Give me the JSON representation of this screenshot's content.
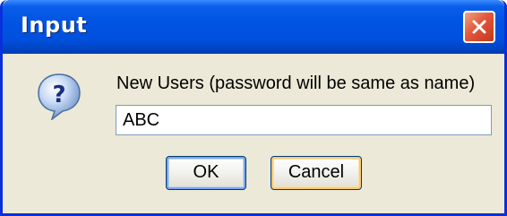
{
  "dialog": {
    "title": "Input",
    "prompt": "New Users (password will be same as name)",
    "input_value": "ABC",
    "ok_label": "OK",
    "cancel_label": "Cancel",
    "icons": {
      "close": "close-icon",
      "question": "question-icon"
    }
  },
  "colors": {
    "titlebar": "#0054e3",
    "close_button": "#e3573b",
    "dialog_background": "#ece9d8",
    "input_border": "#7f9db9",
    "focus_blue": "#7aa5e8",
    "hover_orange": "#f8c877"
  }
}
